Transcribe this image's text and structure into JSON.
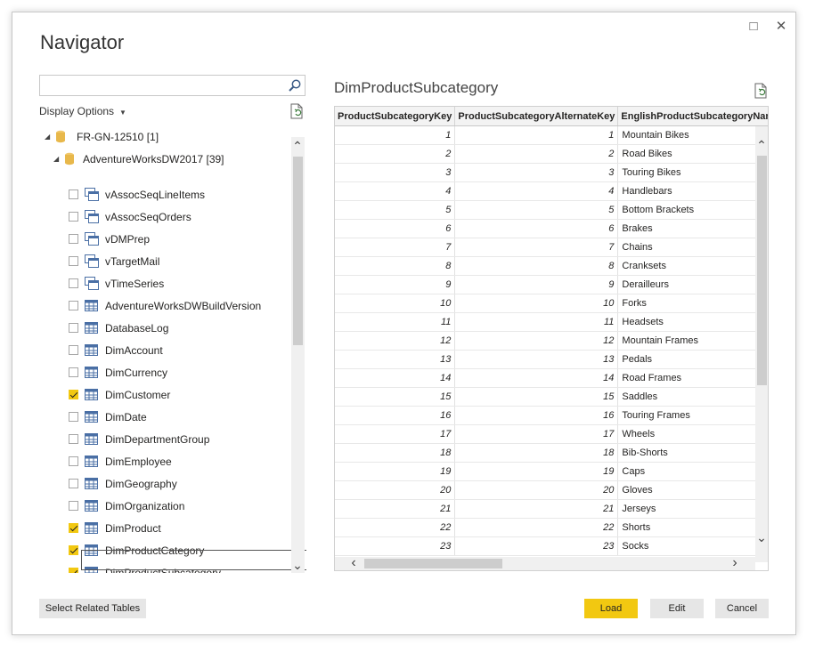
{
  "dialog": {
    "title": "Navigator",
    "maximize_icon": "□",
    "close_icon": "✕"
  },
  "left": {
    "search_placeholder": "",
    "display_options": "Display Options",
    "tree": {
      "server": "FR-GN-12510 [1]",
      "database": "AdventureWorksDW2017 [39]",
      "items": [
        {
          "label": "vAssocSeqLineItems",
          "type": "view",
          "checked": false
        },
        {
          "label": "vAssocSeqOrders",
          "type": "view",
          "checked": false
        },
        {
          "label": "vDMPrep",
          "type": "view",
          "checked": false
        },
        {
          "label": "vTargetMail",
          "type": "view",
          "checked": false
        },
        {
          "label": "vTimeSeries",
          "type": "view",
          "checked": false
        },
        {
          "label": "AdventureWorksDWBuildVersion",
          "type": "table",
          "checked": false
        },
        {
          "label": "DatabaseLog",
          "type": "table",
          "checked": false
        },
        {
          "label": "DimAccount",
          "type": "table",
          "checked": false
        },
        {
          "label": "DimCurrency",
          "type": "table",
          "checked": false
        },
        {
          "label": "DimCustomer",
          "type": "table",
          "checked": true
        },
        {
          "label": "DimDate",
          "type": "table",
          "checked": false
        },
        {
          "label": "DimDepartmentGroup",
          "type": "table",
          "checked": false
        },
        {
          "label": "DimEmployee",
          "type": "table",
          "checked": false
        },
        {
          "label": "DimGeography",
          "type": "table",
          "checked": false
        },
        {
          "label": "DimOrganization",
          "type": "table",
          "checked": false
        },
        {
          "label": "DimProduct",
          "type": "table",
          "checked": true
        },
        {
          "label": "DimProductCategory",
          "type": "table",
          "checked": true
        },
        {
          "label": "DimProductSubcategory",
          "type": "table",
          "checked": true,
          "selected": true
        }
      ]
    }
  },
  "preview": {
    "title": "DimProductSubcategory",
    "columns": [
      "ProductSubcategoryKey",
      "ProductSubcategoryAlternateKey",
      "EnglishProductSubcategoryName"
    ],
    "rows": [
      [
        "1",
        "1",
        "Mountain Bikes"
      ],
      [
        "2",
        "2",
        "Road Bikes"
      ],
      [
        "3",
        "3",
        "Touring Bikes"
      ],
      [
        "4",
        "4",
        "Handlebars"
      ],
      [
        "5",
        "5",
        "Bottom Brackets"
      ],
      [
        "6",
        "6",
        "Brakes"
      ],
      [
        "7",
        "7",
        "Chains"
      ],
      [
        "8",
        "8",
        "Cranksets"
      ],
      [
        "9",
        "9",
        "Derailleurs"
      ],
      [
        "10",
        "10",
        "Forks"
      ],
      [
        "11",
        "11",
        "Headsets"
      ],
      [
        "12",
        "12",
        "Mountain Frames"
      ],
      [
        "13",
        "13",
        "Pedals"
      ],
      [
        "14",
        "14",
        "Road Frames"
      ],
      [
        "15",
        "15",
        "Saddles"
      ],
      [
        "16",
        "16",
        "Touring Frames"
      ],
      [
        "17",
        "17",
        "Wheels"
      ],
      [
        "18",
        "18",
        "Bib-Shorts"
      ],
      [
        "19",
        "19",
        "Caps"
      ],
      [
        "20",
        "20",
        "Gloves"
      ],
      [
        "21",
        "21",
        "Jerseys"
      ],
      [
        "22",
        "22",
        "Shorts"
      ],
      [
        "23",
        "23",
        "Socks"
      ]
    ]
  },
  "footer": {
    "select_related": "Select Related Tables",
    "load": "Load",
    "edit": "Edit",
    "cancel": "Cancel"
  },
  "colors": {
    "accent": "#f2c811",
    "database_icon": "#e8b84b",
    "table_icon": "#4a6fa5"
  }
}
